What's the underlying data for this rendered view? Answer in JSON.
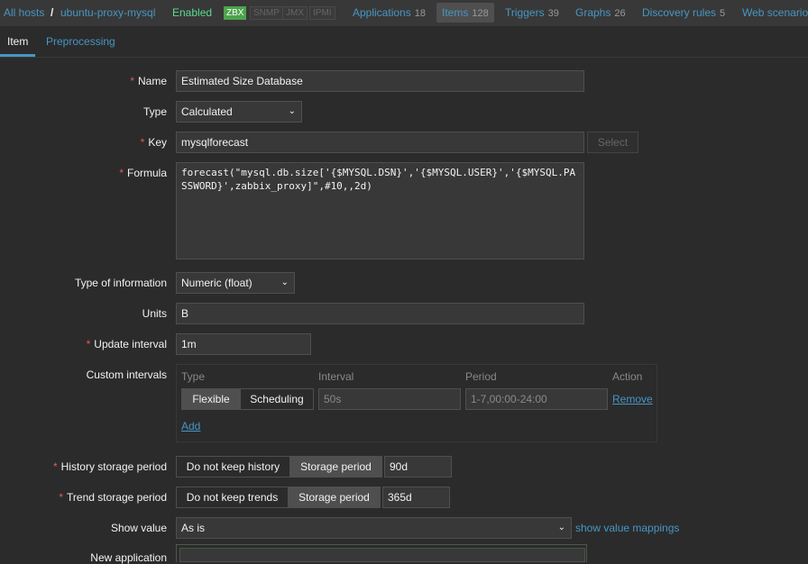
{
  "header": {
    "breadcrumb": {
      "all_hosts": "All hosts",
      "separator": "/",
      "host": "ubuntu-proxy-mysql"
    },
    "status": "Enabled",
    "badges": [
      "ZBX",
      "SNMP",
      "JMX",
      "IPMI"
    ],
    "nav": [
      {
        "label": "Applications",
        "count": "18"
      },
      {
        "label": "Items",
        "count": "128"
      },
      {
        "label": "Triggers",
        "count": "39"
      },
      {
        "label": "Graphs",
        "count": "26"
      },
      {
        "label": "Discovery rules",
        "count": "5"
      },
      {
        "label": "Web scenario",
        "count": ""
      }
    ]
  },
  "tabs": [
    "Item",
    "Preprocessing"
  ],
  "form": {
    "name": {
      "label": "Name",
      "value": "Estimated Size Database"
    },
    "type": {
      "label": "Type",
      "value": "Calculated"
    },
    "key": {
      "label": "Key",
      "value": "mysqlforecast",
      "select": "Select"
    },
    "formula": {
      "label": "Formula",
      "value": "forecast(\"mysql.db.size['{$MYSQL.DSN}','{$MYSQL.USER}','{$MYSQL.PASSWORD}',zabbix_proxy]\",#10,,2d)"
    },
    "type_of_information": {
      "label": "Type of information",
      "value": "Numeric (float)"
    },
    "units": {
      "label": "Units",
      "value": "B"
    },
    "update_interval": {
      "label": "Update interval",
      "value": "1m"
    },
    "custom_intervals": {
      "label": "Custom intervals",
      "headers": [
        "Type",
        "Interval",
        "Period",
        "Action"
      ],
      "row": {
        "flexible": "Flexible",
        "scheduling": "Scheduling",
        "interval": "50s",
        "period": "1-7,00:00-24:00",
        "remove": "Remove"
      },
      "add": "Add"
    },
    "history": {
      "label": "History storage period",
      "opt_off": "Do not keep history",
      "opt_on": "Storage period",
      "value": "90d"
    },
    "trend": {
      "label": "Trend storage period",
      "opt_off": "Do not keep trends",
      "opt_on": "Storage period",
      "value": "365d"
    },
    "show_value": {
      "label": "Show value",
      "value": "As is",
      "link": "show value mappings"
    },
    "new_application": {
      "label": "New application"
    }
  },
  "icons": {
    "chevron": "chevron-down-icon"
  }
}
